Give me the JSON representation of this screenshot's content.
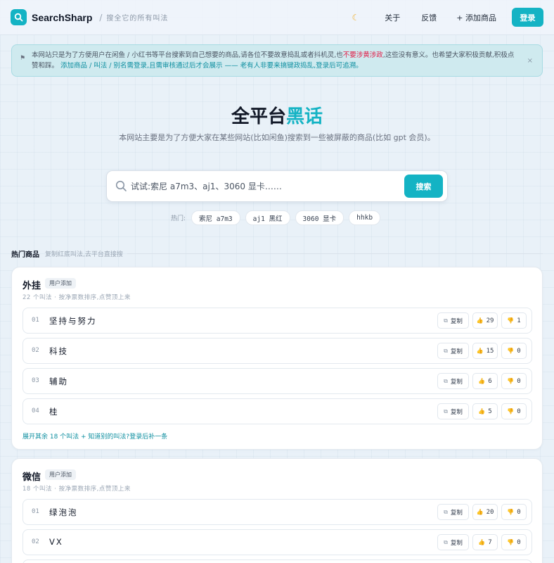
{
  "header": {
    "brand": "SearchSharp",
    "tagline": "搜全它的所有叫法",
    "nav": {
      "about": "关于",
      "feedback": "反馈",
      "add": "+ 添加商品",
      "login": "登录"
    }
  },
  "notice": {
    "text_main": "本网站只是为了方便用户在闲鱼 / 小红书等平台搜索到自己想要的商品,请各位不要故意捣乱或者抖机灵,也",
    "text_danger": "不要涉黄涉政",
    "text_tail": ",这些没有意义。也希望大家积极贡献,积极点赞和踩。",
    "text_accent": "添加商品 / 叫法 / 别名需登录,且需审核通过后才会展示 —— 老有人非要来搞键政捣乱,登录后可追溯。",
    "close": "×"
  },
  "hero": {
    "title_a": "全平台",
    "title_b": "黑话",
    "desc": "本网站主要是为了方便大家在某些网站(比如闲鱼)搜索到一些被屏蔽的商品(比如 gpt 会员)。"
  },
  "search": {
    "placeholder": "试试:索尼 a7m3、aj1、3060 显卡……",
    "button": "搜索"
  },
  "hot": {
    "label": "热门:",
    "chips": [
      "索尼 a7m3",
      "aj1 黑红",
      "3060 显卡",
      "hhkb"
    ]
  },
  "section": {
    "title": "热门商品",
    "sub": "复制红底叫法,去平台直接搜"
  },
  "cards": [
    {
      "title": "外挂",
      "badge": "用户添加",
      "meta": "22 个叫法 · 按净票数排序,点赞顶上来",
      "rows": [
        {
          "num": "01",
          "name": "坚持与努力",
          "copy": "复制",
          "up": "29",
          "down": "1"
        },
        {
          "num": "02",
          "name": "科技",
          "copy": "复制",
          "up": "15",
          "down": "0"
        },
        {
          "num": "03",
          "name": "辅助",
          "copy": "复制",
          "up": "6",
          "down": "0"
        },
        {
          "num": "04",
          "name": "桂",
          "copy": "复制",
          "up": "5",
          "down": "0"
        }
      ],
      "expand": "展开其余 18 个叫法 + 知道别的叫法?登录后补一条"
    },
    {
      "title": "微信",
      "badge": "用户添加",
      "meta": "18 个叫法 · 按净票数排序,点赞顶上来",
      "rows": [
        {
          "num": "01",
          "name": "绿泡泡",
          "copy": "复制",
          "up": "20",
          "down": "0"
        },
        {
          "num": "02",
          "name": "VX",
          "copy": "复制",
          "up": "7",
          "down": "0"
        }
      ]
    }
  ]
}
